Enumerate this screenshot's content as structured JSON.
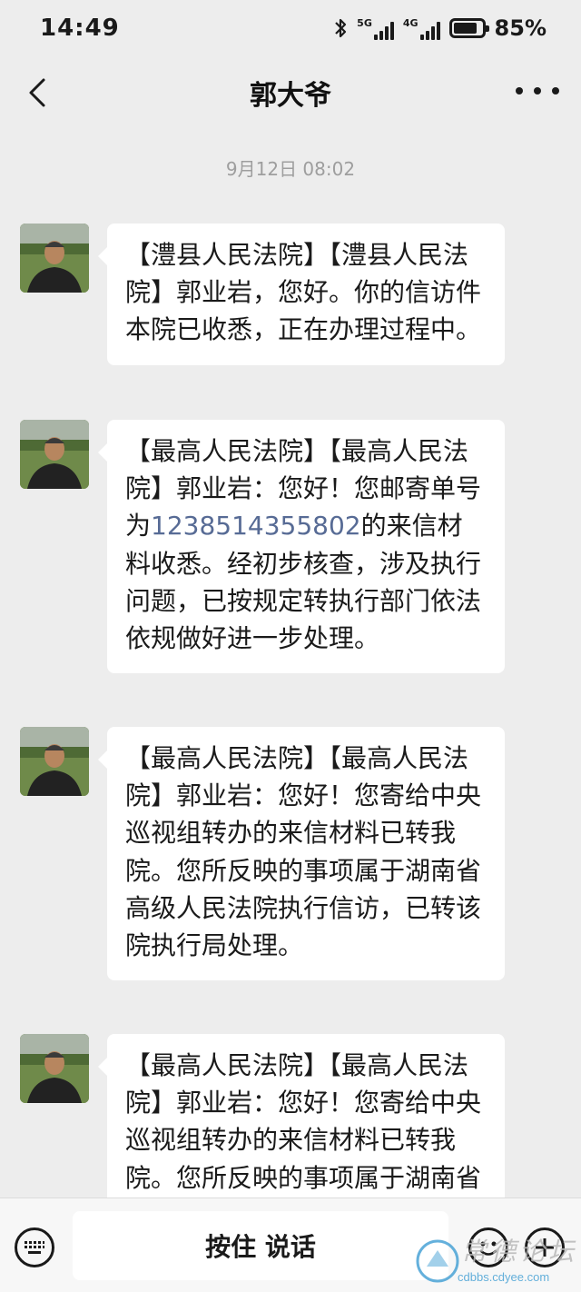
{
  "status_bar": {
    "time": "14:49",
    "net1": "5G",
    "net2": "4G",
    "battery_percent": "85%",
    "battery_level": 0.85
  },
  "header": {
    "title": "郭大爷",
    "back_icon": "chevron-left-icon",
    "more_icon": "more-dots-icon"
  },
  "chat": {
    "timestamp": "9月12日 08:02",
    "messages": [
      {
        "text": "【澧县人民法院】【澧县人民法院】郭业岩，您好。你的信访件本院已收悉，正在办理过程中。"
      },
      {
        "text_before": "【最高人民法院】【最高人民法院】郭业岩：您好！您邮寄单号为",
        "link": "1238514355802",
        "text_after": "的来信材料收悉。经初步核查，涉及执行问题，已按规定转执行部门依法依规做好进一步处理。"
      },
      {
        "text": "【最高人民法院】【最高人民法院】郭业岩：您好！您寄给中央巡视组转办的来信材料已转我院。您所反映的事项属于湖南省高级人民法院执行信访，已转该院执行局处理。"
      },
      {
        "text": "【最高人民法院】【最高人民法院】郭业岩：您好！您寄给中央巡视组转办的来信材料已转我院。您所反映的事项属于湖南省高级人民法院执行信访，已转该院执行局处理。"
      }
    ]
  },
  "input_bar": {
    "voice_label": "按住 说话",
    "keyboard_icon": "keyboard-icon",
    "emoji_icon": "emoji-icon",
    "plus_icon": "plus-icon"
  },
  "watermark": {
    "text": "常德论坛",
    "url": "cdbbs.cdyee.com"
  }
}
